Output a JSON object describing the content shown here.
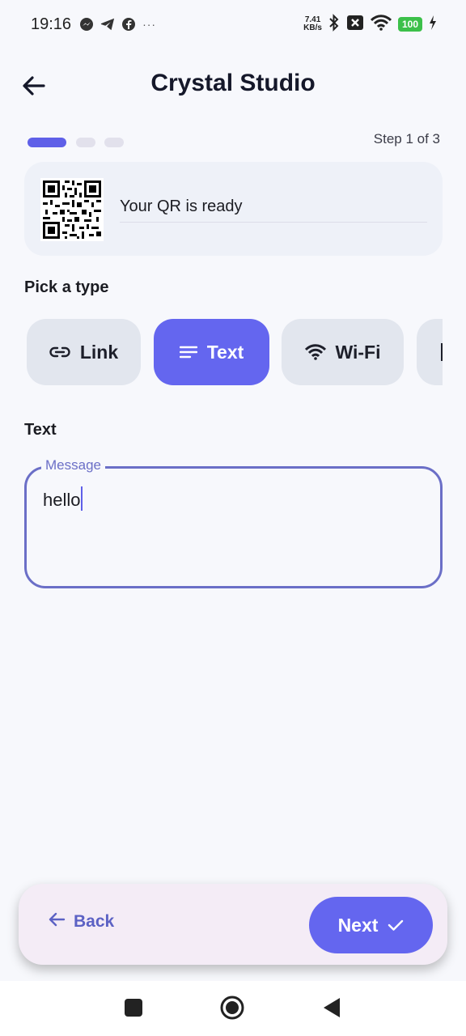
{
  "status_bar": {
    "time": "19:16",
    "net_speed_value": "7.41",
    "net_speed_unit": "KB/s",
    "battery": "100",
    "icons": [
      "messenger-icon",
      "telegram-icon",
      "facebook-icon",
      "more-dots-icon",
      "bluetooth-icon",
      "sim-off-icon",
      "wifi-icon",
      "battery-icon",
      "charging-icon"
    ],
    "more": "···"
  },
  "header": {
    "title": "Crystal Studio",
    "back_icon": "arrow-left-icon"
  },
  "stepper": {
    "label": "Step 1 of 3",
    "current": 1,
    "total": 3
  },
  "qr_card": {
    "status_text": "Your QR is ready"
  },
  "type_picker": {
    "label": "Pick a type",
    "chips": [
      {
        "label": "Link",
        "icon": "link-icon",
        "selected": false
      },
      {
        "label": "Text",
        "icon": "text-lines-icon",
        "selected": true
      },
      {
        "label": "Wi-Fi",
        "icon": "wifi-icon",
        "selected": false
      }
    ]
  },
  "text_section": {
    "label": "Text",
    "field_label": "Message",
    "value": "hello"
  },
  "bottom_bar": {
    "back_label": "Back",
    "next_label": "Next"
  },
  "colors": {
    "accent": "#6466EF",
    "background": "#F7F8FC",
    "chip": "#E2E6EE",
    "field_border": "#6B6FC7",
    "bottom_bar": "#F4ECF6"
  }
}
